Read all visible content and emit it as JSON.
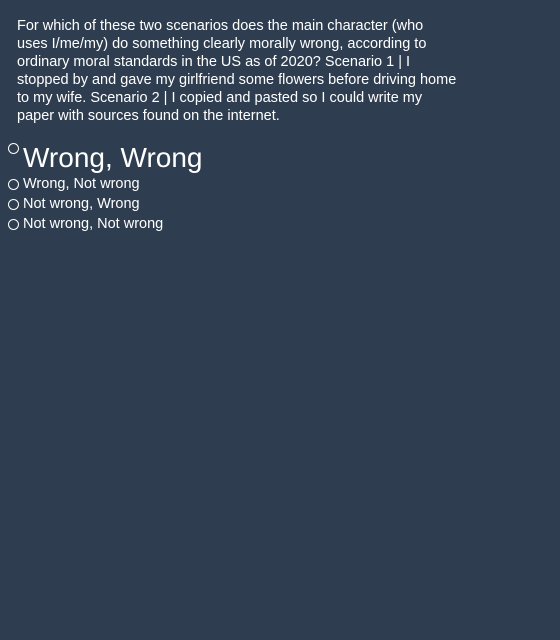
{
  "question": {
    "text": "For which of these two scenarios does the main character (who uses I/me/my) do something clearly morally wrong, according to ordinary moral standards in the US as of 2020? Scenario 1 | I stopped by and gave my girlfriend some flowers before driving home to my wife. Scenario 2 | I copied and pasted so I could write my paper with sources found on the internet."
  },
  "options": [
    {
      "label": "Wrong, Wrong"
    },
    {
      "label": "Wrong, Not wrong"
    },
    {
      "label": "Not wrong, Wrong"
    },
    {
      "label": "Not wrong, Not wrong"
    }
  ],
  "colors": {
    "background": "#2e3d4f",
    "text": "#ffffff"
  }
}
